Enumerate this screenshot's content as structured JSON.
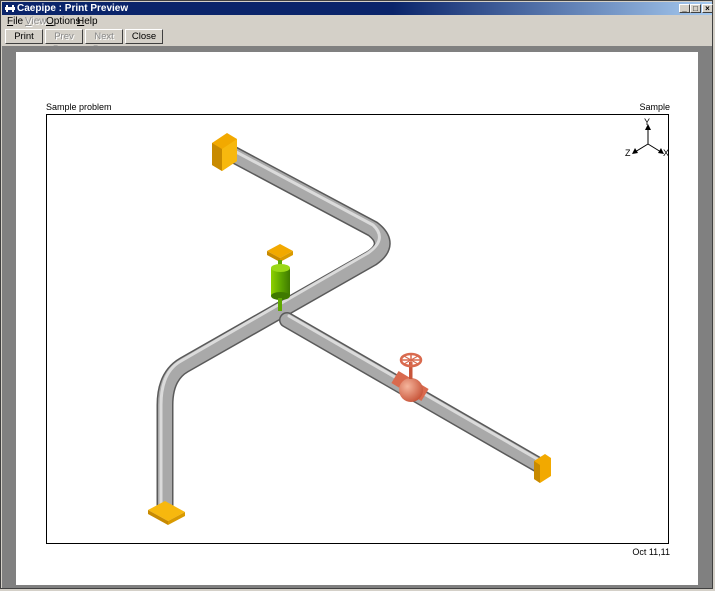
{
  "window": {
    "title": "Caepipe : Print Preview",
    "icon": "caepipe-app-icon",
    "controls": {
      "minimize": "_",
      "maximize": "□",
      "close": "×"
    }
  },
  "menu": {
    "file": {
      "mnemonic": "F",
      "rest": "ile"
    },
    "view": {
      "mnemonic": "V",
      "rest": "iew"
    },
    "options": {
      "mnemonic": "O",
      "rest": "ptions"
    },
    "help": {
      "mnemonic": "H",
      "rest": "elp"
    }
  },
  "toolbar": {
    "print": "Print",
    "prev_page": "Prev Page",
    "next_page": "Next Page",
    "close": "Close"
  },
  "page": {
    "header_left": "Sample problem",
    "header_right": "Sample",
    "date": "Oct 11,11"
  },
  "axis_triad": {
    "y": "Y",
    "z": "Z",
    "x": "X"
  },
  "colors": {
    "pipe": "#a9a9a9",
    "anchor": "#f2a900",
    "hanger": "#5fa800",
    "valve": "#e07a5f"
  }
}
